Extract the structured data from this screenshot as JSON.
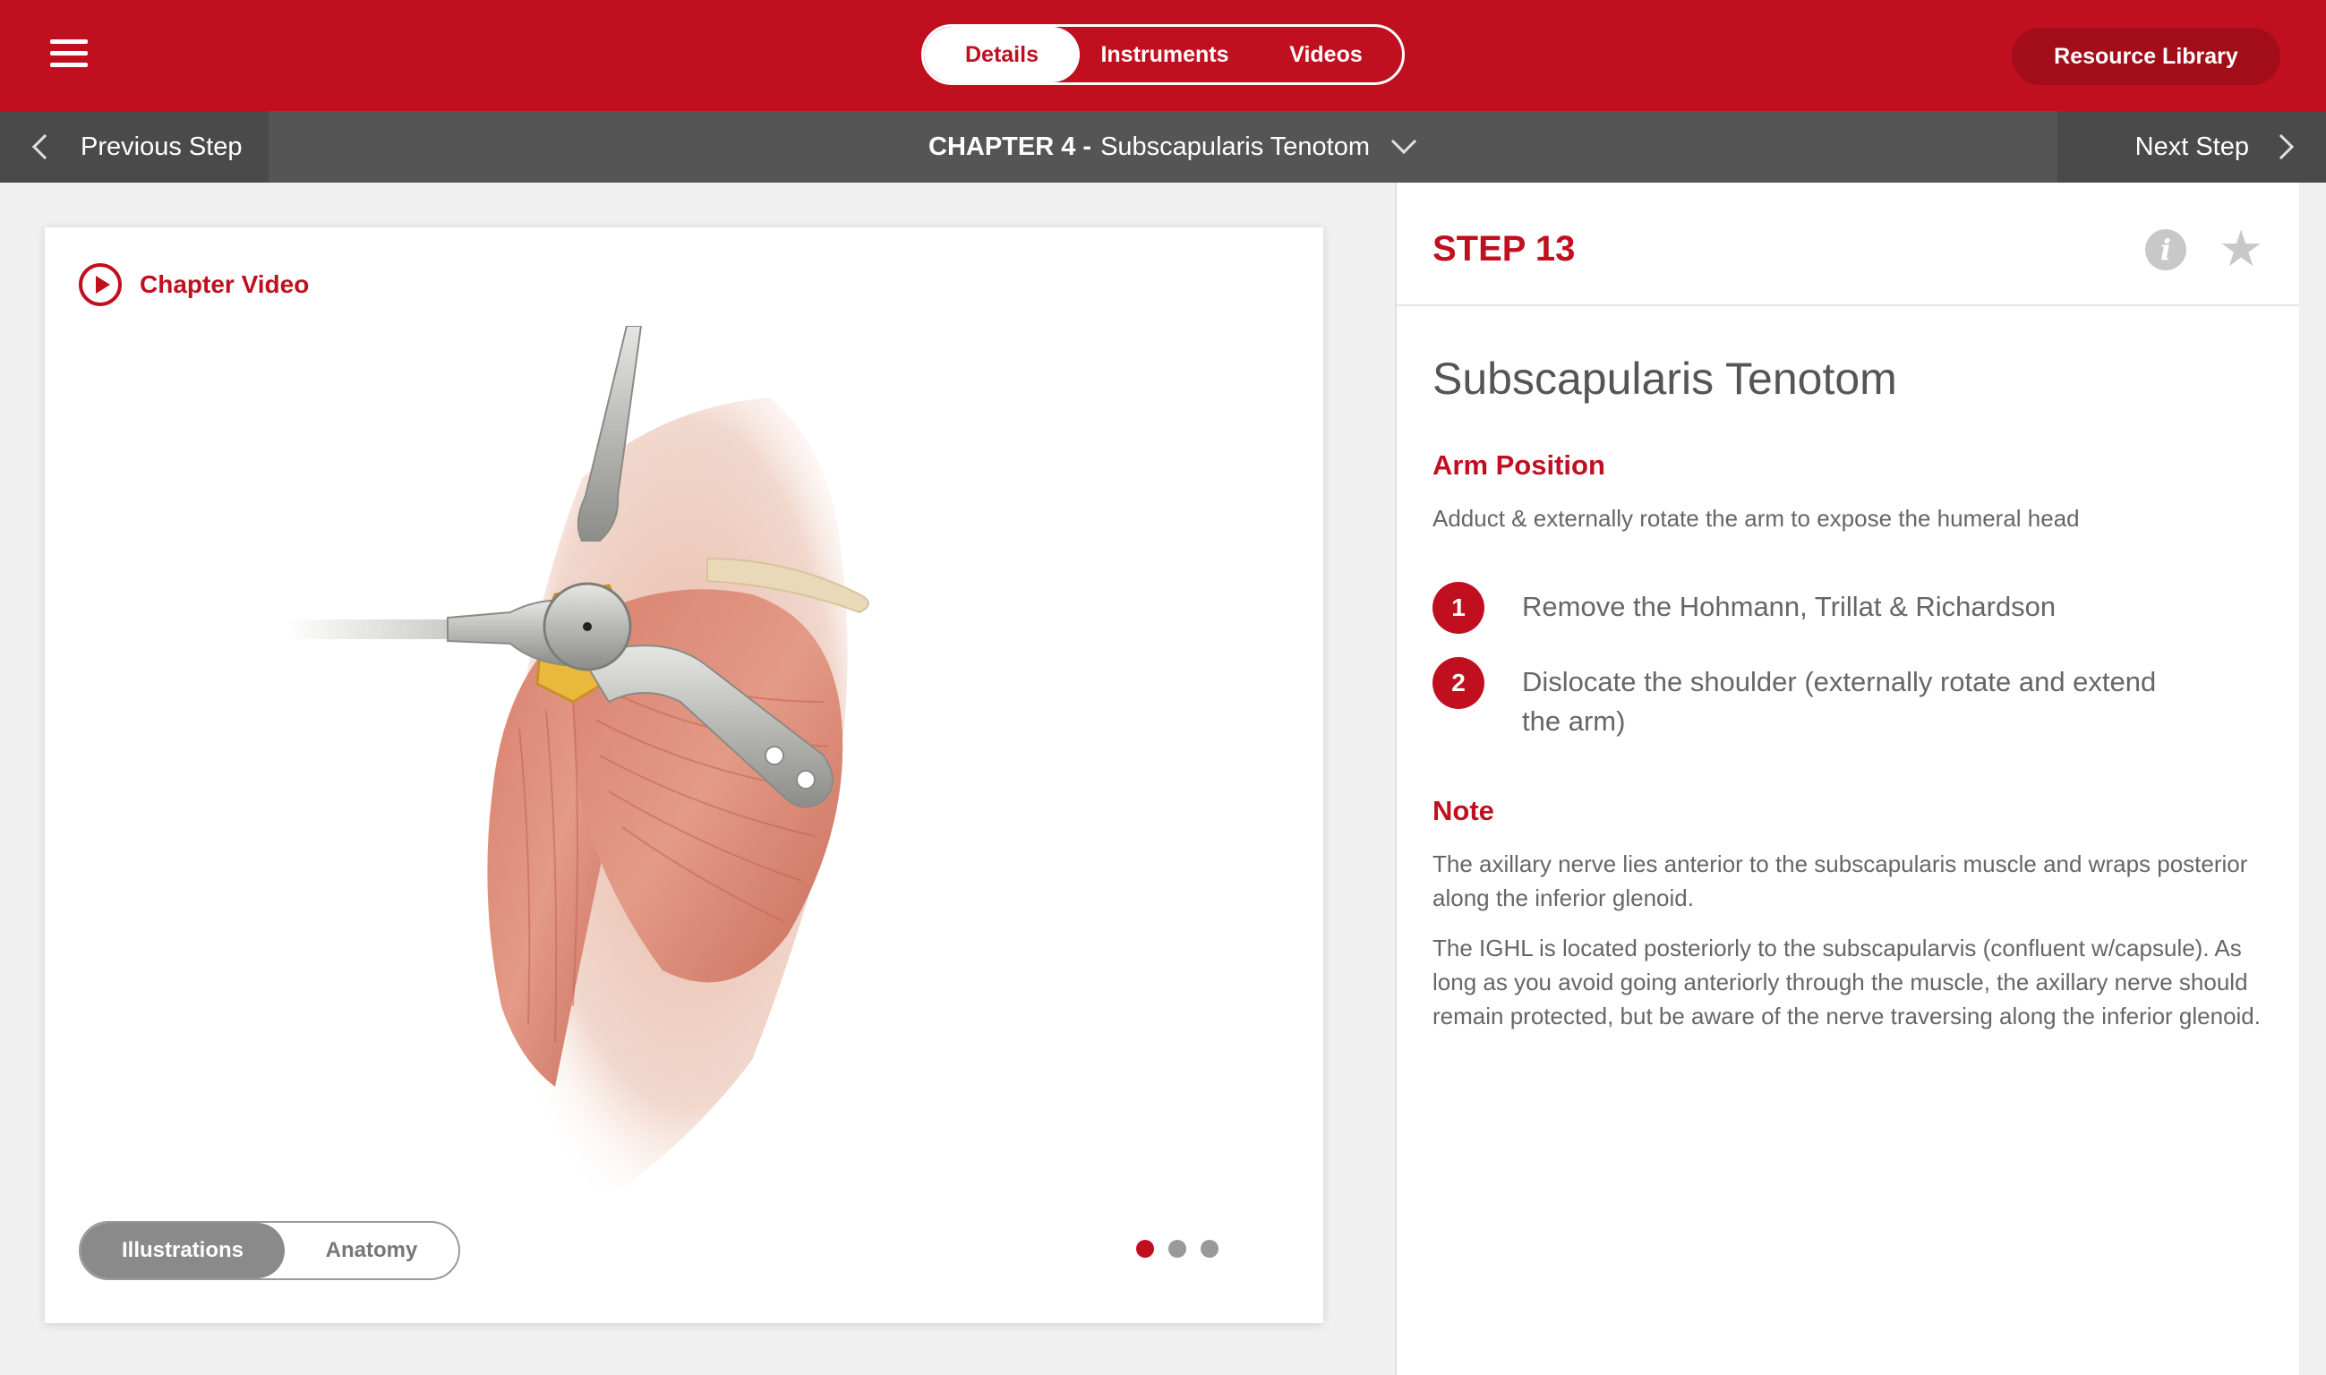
{
  "header": {
    "tabs": [
      {
        "label": "Details",
        "active": true
      },
      {
        "label": "Instruments",
        "active": false
      },
      {
        "label": "Videos",
        "active": false
      }
    ],
    "resource_library": "Resource Library"
  },
  "stepnav": {
    "previous": "Previous Step",
    "next": "Next Step",
    "chapter_prefix": "CHAPTER 4 -",
    "chapter_title": "Subscapularis Tenotom"
  },
  "media": {
    "chapter_video": "Chapter Video",
    "toggle": {
      "illustrations": "Illustrations",
      "anatomy": "Anatomy",
      "selected": "Illustrations"
    },
    "carousel": {
      "total": 3,
      "current": 1
    }
  },
  "panel": {
    "step_title": "STEP 13",
    "title": "Subscapularis Tenotom",
    "arm_position_heading": "Arm Position",
    "arm_position_text": "Adduct & externally rotate the arm to expose the humeral head",
    "steps": [
      {
        "num": "1",
        "text": "Remove the Hohmann, Trillat & Richardson"
      },
      {
        "num": "2",
        "text": "Dislocate the shoulder (externally rotate and extend the arm)"
      }
    ],
    "note_heading": "Note",
    "note_paragraphs": [
      "The axillary nerve lies anterior to the subscapularis muscle and wraps posterior along the inferior glenoid.",
      "The IGHL is located posteriorly to the subscapularvis (confluent w/capsule). As long as you avoid going anteriorly through the muscle, the axillary nerve should remain protected, but be aware of the nerve traversing along the inferior glenoid."
    ]
  },
  "colors": {
    "brand_red": "#c0101f",
    "nav_gray": "#555555"
  }
}
